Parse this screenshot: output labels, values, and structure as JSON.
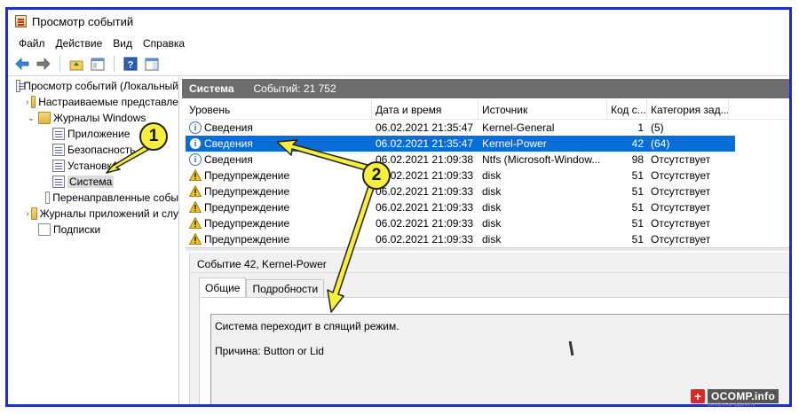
{
  "window": {
    "title": "Просмотр событий"
  },
  "menu": [
    "Файл",
    "Действие",
    "Вид",
    "Справка"
  ],
  "toolbar": {
    "icons": [
      "back-arrow-icon",
      "forward-arrow-icon",
      "folder-up-icon",
      "properties-icon",
      "help-icon",
      "panel-icon"
    ]
  },
  "tree": [
    {
      "label": "Просмотр событий (Локальный",
      "indent": 0,
      "chev": "",
      "icon": "log"
    },
    {
      "label": "Настраиваемые представле",
      "indent": 1,
      "chev": "›",
      "icon": "folder"
    },
    {
      "label": "Журналы Windows",
      "indent": 1,
      "chev": "⌄",
      "icon": "folder"
    },
    {
      "label": "Приложение",
      "indent": 2,
      "chev": "",
      "icon": "log"
    },
    {
      "label": "Безопасность",
      "indent": 2,
      "chev": "",
      "icon": "log"
    },
    {
      "label": "Установка",
      "indent": 2,
      "chev": "",
      "icon": "log"
    },
    {
      "label": "Система",
      "indent": 2,
      "chev": "",
      "icon": "log",
      "selected": true
    },
    {
      "label": "Перенаправленные собы",
      "indent": 2,
      "chev": "",
      "icon": "doc"
    },
    {
      "label": "Журналы приложений и слу",
      "indent": 1,
      "chev": "›",
      "icon": "folder"
    },
    {
      "label": "Подписки",
      "indent": 1,
      "chev": "",
      "icon": "doc"
    }
  ],
  "header": {
    "title": "Система",
    "count": "Событий: 21 752"
  },
  "table": {
    "columns": [
      "Уровень",
      "Дата и время",
      "Источник",
      "Код с...",
      "Категория зад..."
    ],
    "rows": [
      {
        "level": "Сведения",
        "type": "info",
        "date": "06.02.2021 21:35:47",
        "source": "Kernel-General",
        "code": "1",
        "category": "(5)"
      },
      {
        "level": "Сведения",
        "type": "info",
        "date": "06.02.2021 21:35:47",
        "source": "Kernel-Power",
        "code": "42",
        "category": "(64)",
        "selected": true
      },
      {
        "level": "Сведения",
        "type": "info",
        "date": "06.02.2021 21:09:38",
        "source": "Ntfs (Microsoft-Window...",
        "code": "98",
        "category": "Отсутствует"
      },
      {
        "level": "Предупреждение",
        "type": "warn",
        "date": "06.02.2021 21:09:33",
        "source": "disk",
        "code": "51",
        "category": "Отсутствует"
      },
      {
        "level": "Предупреждение",
        "type": "warn",
        "date": "06.02.2021 21:09:33",
        "source": "disk",
        "code": "51",
        "category": "Отсутствует"
      },
      {
        "level": "Предупреждение",
        "type": "warn",
        "date": "06.02.2021 21:09:33",
        "source": "disk",
        "code": "51",
        "category": "Отсутствует"
      },
      {
        "level": "Предупреждение",
        "type": "warn",
        "date": "06.02.2021 21:09:33",
        "source": "disk",
        "code": "51",
        "category": "Отсутствует"
      },
      {
        "level": "Предупреждение",
        "type": "warn",
        "date": "06.02.2021 21:09:33",
        "source": "disk",
        "code": "51",
        "category": "Отсутствует"
      }
    ]
  },
  "detail": {
    "title": "Событие 42, Kernel-Power",
    "tabs": [
      "Общие",
      "Подробности"
    ],
    "message": "Система переходит в спящий режим.",
    "reason": "Причина: Button or Lid"
  },
  "annotations": {
    "badge1": "1",
    "badge2": "2"
  },
  "watermark": {
    "text": "OCOMP.info",
    "sub": "вопросы админу"
  },
  "colors": {
    "selection": "#0a6cd6",
    "header_strip": "#6d6d6d",
    "frame": "#1f2fbf",
    "badge": "#f6ef3c"
  }
}
